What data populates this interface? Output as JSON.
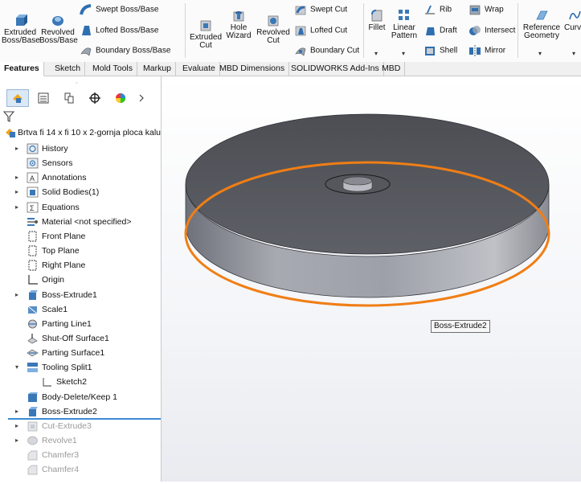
{
  "ribbon": {
    "extruded_boss": "Extruded\nBoss/Base",
    "revolved_boss": "Revolved\nBoss/Base",
    "swept_boss": "Swept Boss/Base",
    "lofted_boss": "Lofted Boss/Base",
    "boundary_boss": "Boundary Boss/Base",
    "extruded_cut": "Extruded\nCut",
    "hole_wizard": "Hole\nWizard",
    "revolved_cut": "Revolved\nCut",
    "swept_cut": "Swept Cut",
    "lofted_cut": "Lofted Cut",
    "boundary_cut": "Boundary Cut",
    "fillet": "Fillet",
    "linear_pattern": "Linear\nPattern",
    "rib": "Rib",
    "draft": "Draft",
    "shell": "Shell",
    "wrap": "Wrap",
    "intersect": "Intersect",
    "mirror": "Mirror",
    "reference_geometry": "Reference\nGeometry",
    "curves": "Curve"
  },
  "tabs": [
    "Features",
    "Sketch",
    "Mold Tools",
    "Markup",
    "Evaluate",
    "MBD Dimensions",
    "SOLIDWORKS Add-Ins",
    "MBD"
  ],
  "tree": {
    "root": "Brtva fi 14 x fi 10 x 2-gornja ploca kalu",
    "items": [
      {
        "label": "History",
        "arrow": true,
        "dim": false
      },
      {
        "label": "Sensors",
        "arrow": false,
        "dim": false
      },
      {
        "label": "Annotations",
        "arrow": true,
        "dim": false
      },
      {
        "label": "Solid Bodies(1)",
        "arrow": true,
        "dim": false
      },
      {
        "label": "Equations",
        "arrow": true,
        "dim": false
      },
      {
        "label": "Material <not specified>",
        "arrow": false,
        "dim": false
      },
      {
        "label": "Front Plane",
        "arrow": false,
        "dim": false
      },
      {
        "label": "Top Plane",
        "arrow": false,
        "dim": false
      },
      {
        "label": "Right Plane",
        "arrow": false,
        "dim": false
      },
      {
        "label": "Origin",
        "arrow": false,
        "dim": false
      },
      {
        "label": "Boss-Extrude1",
        "arrow": true,
        "dim": false
      },
      {
        "label": "Scale1",
        "arrow": false,
        "dim": false
      },
      {
        "label": "Parting Line1",
        "arrow": false,
        "dim": false
      },
      {
        "label": "Shut-Off Surface1",
        "arrow": false,
        "dim": false
      },
      {
        "label": "Parting Surface1",
        "arrow": false,
        "dim": false
      },
      {
        "label": "Tooling Split1",
        "arrow": true,
        "dim": false
      },
      {
        "label": "Sketch2",
        "arrow": false,
        "dim": false
      },
      {
        "label": "Body-Delete/Keep 1",
        "arrow": false,
        "dim": false
      },
      {
        "label": "Boss-Extrude2",
        "arrow": true,
        "dim": false
      },
      {
        "label": "Cut-Extrude3",
        "arrow": true,
        "dim": true
      },
      {
        "label": "Revolve1",
        "arrow": true,
        "dim": true
      },
      {
        "label": "Chamfer3",
        "arrow": false,
        "dim": true
      },
      {
        "label": "Chamfer4",
        "arrow": false,
        "dim": true
      }
    ]
  },
  "viewport": {
    "tooltip": "Boss-Extrude2",
    "highlight_color": "#f07e15",
    "body_color": "#55575d"
  }
}
